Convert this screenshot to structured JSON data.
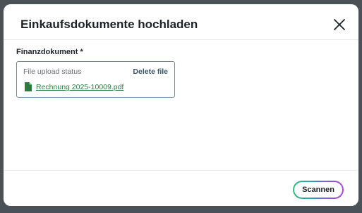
{
  "dialog": {
    "title": "Einkaufsdokumente hochladen"
  },
  "form": {
    "field_label": "Finanzdokument *",
    "upload": {
      "status_label": "File upload status",
      "delete_label": "Delete file",
      "file_name": "Rechnung 2025-10009.pdf",
      "file_icon": "document-icon",
      "file_icon_color": "#2c7a3f"
    }
  },
  "footer": {
    "scan_label": "Scannen"
  },
  "colors": {
    "overlay": "#4b5257",
    "link": "#2c7a3f",
    "delete_text": "#3a5466",
    "border": "#6e8a9c"
  }
}
